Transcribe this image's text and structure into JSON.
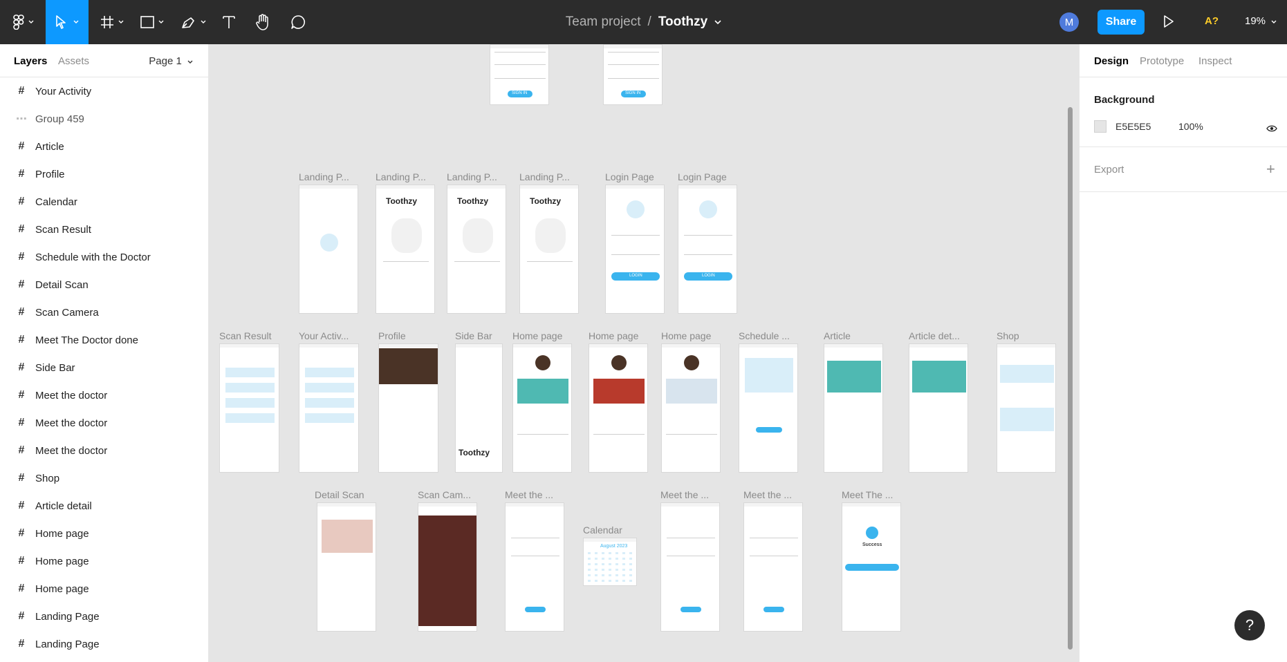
{
  "toolbar": {
    "team": "Team project",
    "separator": "/",
    "file": "Toothzy",
    "avatar": "M",
    "share": "Share",
    "font_warning": "A?",
    "zoom": "19%"
  },
  "left_panel": {
    "tab_layers": "Layers",
    "tab_assets": "Assets",
    "page": "Page 1",
    "layers": [
      {
        "name": "Your Activity",
        "icon": "frame-icon"
      },
      {
        "name": "Group 459",
        "icon": "group-icon"
      },
      {
        "name": "Article",
        "icon": "frame-icon"
      },
      {
        "name": "Profile",
        "icon": "frame-icon"
      },
      {
        "name": "Calendar",
        "icon": "frame-icon"
      },
      {
        "name": "Scan Result",
        "icon": "frame-icon"
      },
      {
        "name": "Schedule with the Doctor",
        "icon": "frame-icon"
      },
      {
        "name": "Detail Scan",
        "icon": "frame-icon"
      },
      {
        "name": "Scan Camera",
        "icon": "frame-icon"
      },
      {
        "name": "Meet The Doctor done",
        "icon": "frame-icon"
      },
      {
        "name": "Side Bar",
        "icon": "frame-icon"
      },
      {
        "name": "Meet the doctor",
        "icon": "frame-icon"
      },
      {
        "name": "Meet the doctor",
        "icon": "frame-icon"
      },
      {
        "name": "Meet the doctor",
        "icon": "frame-icon"
      },
      {
        "name": "Shop",
        "icon": "frame-icon"
      },
      {
        "name": "Article detail",
        "icon": "frame-icon"
      },
      {
        "name": "Home page",
        "icon": "frame-icon"
      },
      {
        "name": "Home page",
        "icon": "frame-icon"
      },
      {
        "name": "Home page",
        "icon": "frame-icon"
      },
      {
        "name": "Landing Page",
        "icon": "frame-icon"
      },
      {
        "name": "Landing Page",
        "icon": "frame-icon"
      }
    ]
  },
  "right_panel": {
    "tab_design": "Design",
    "tab_prototype": "Prototype",
    "tab_inspect": "Inspect",
    "background_title": "Background",
    "bg_hex": "E5E5E5",
    "bg_opacity": "100%",
    "export_title": "Export",
    "export_add": "+"
  },
  "canvas": {
    "row1_labels": [
      "Landing P...",
      "Landing P...",
      "Landing P...",
      "Landing P...",
      "Login Page",
      "Login Page"
    ],
    "row2_labels": [
      "Scan Result",
      "Your Activ...",
      "Profile",
      "Side Bar",
      "Home page",
      "Home page",
      "Home page",
      "Schedule ...",
      "Article",
      "Article det...",
      "Shop"
    ],
    "row3_labels": [
      "Detail Scan",
      "Scan Cam...",
      "Meet the ...",
      "Calendar",
      "Meet the ...",
      "Meet the ...",
      "Meet The ..."
    ],
    "brand": "Toothzy",
    "sign_in": "SIGN IN",
    "login": "LOGIN",
    "success": "Success",
    "calendar_month": "August 2023"
  },
  "help": "?",
  "colors": {
    "accent": "#0d99ff",
    "toolbar_bg": "#2c2c2c",
    "canvas_bg": "#e5e5e5",
    "app_blue": "#3ab4ee"
  }
}
